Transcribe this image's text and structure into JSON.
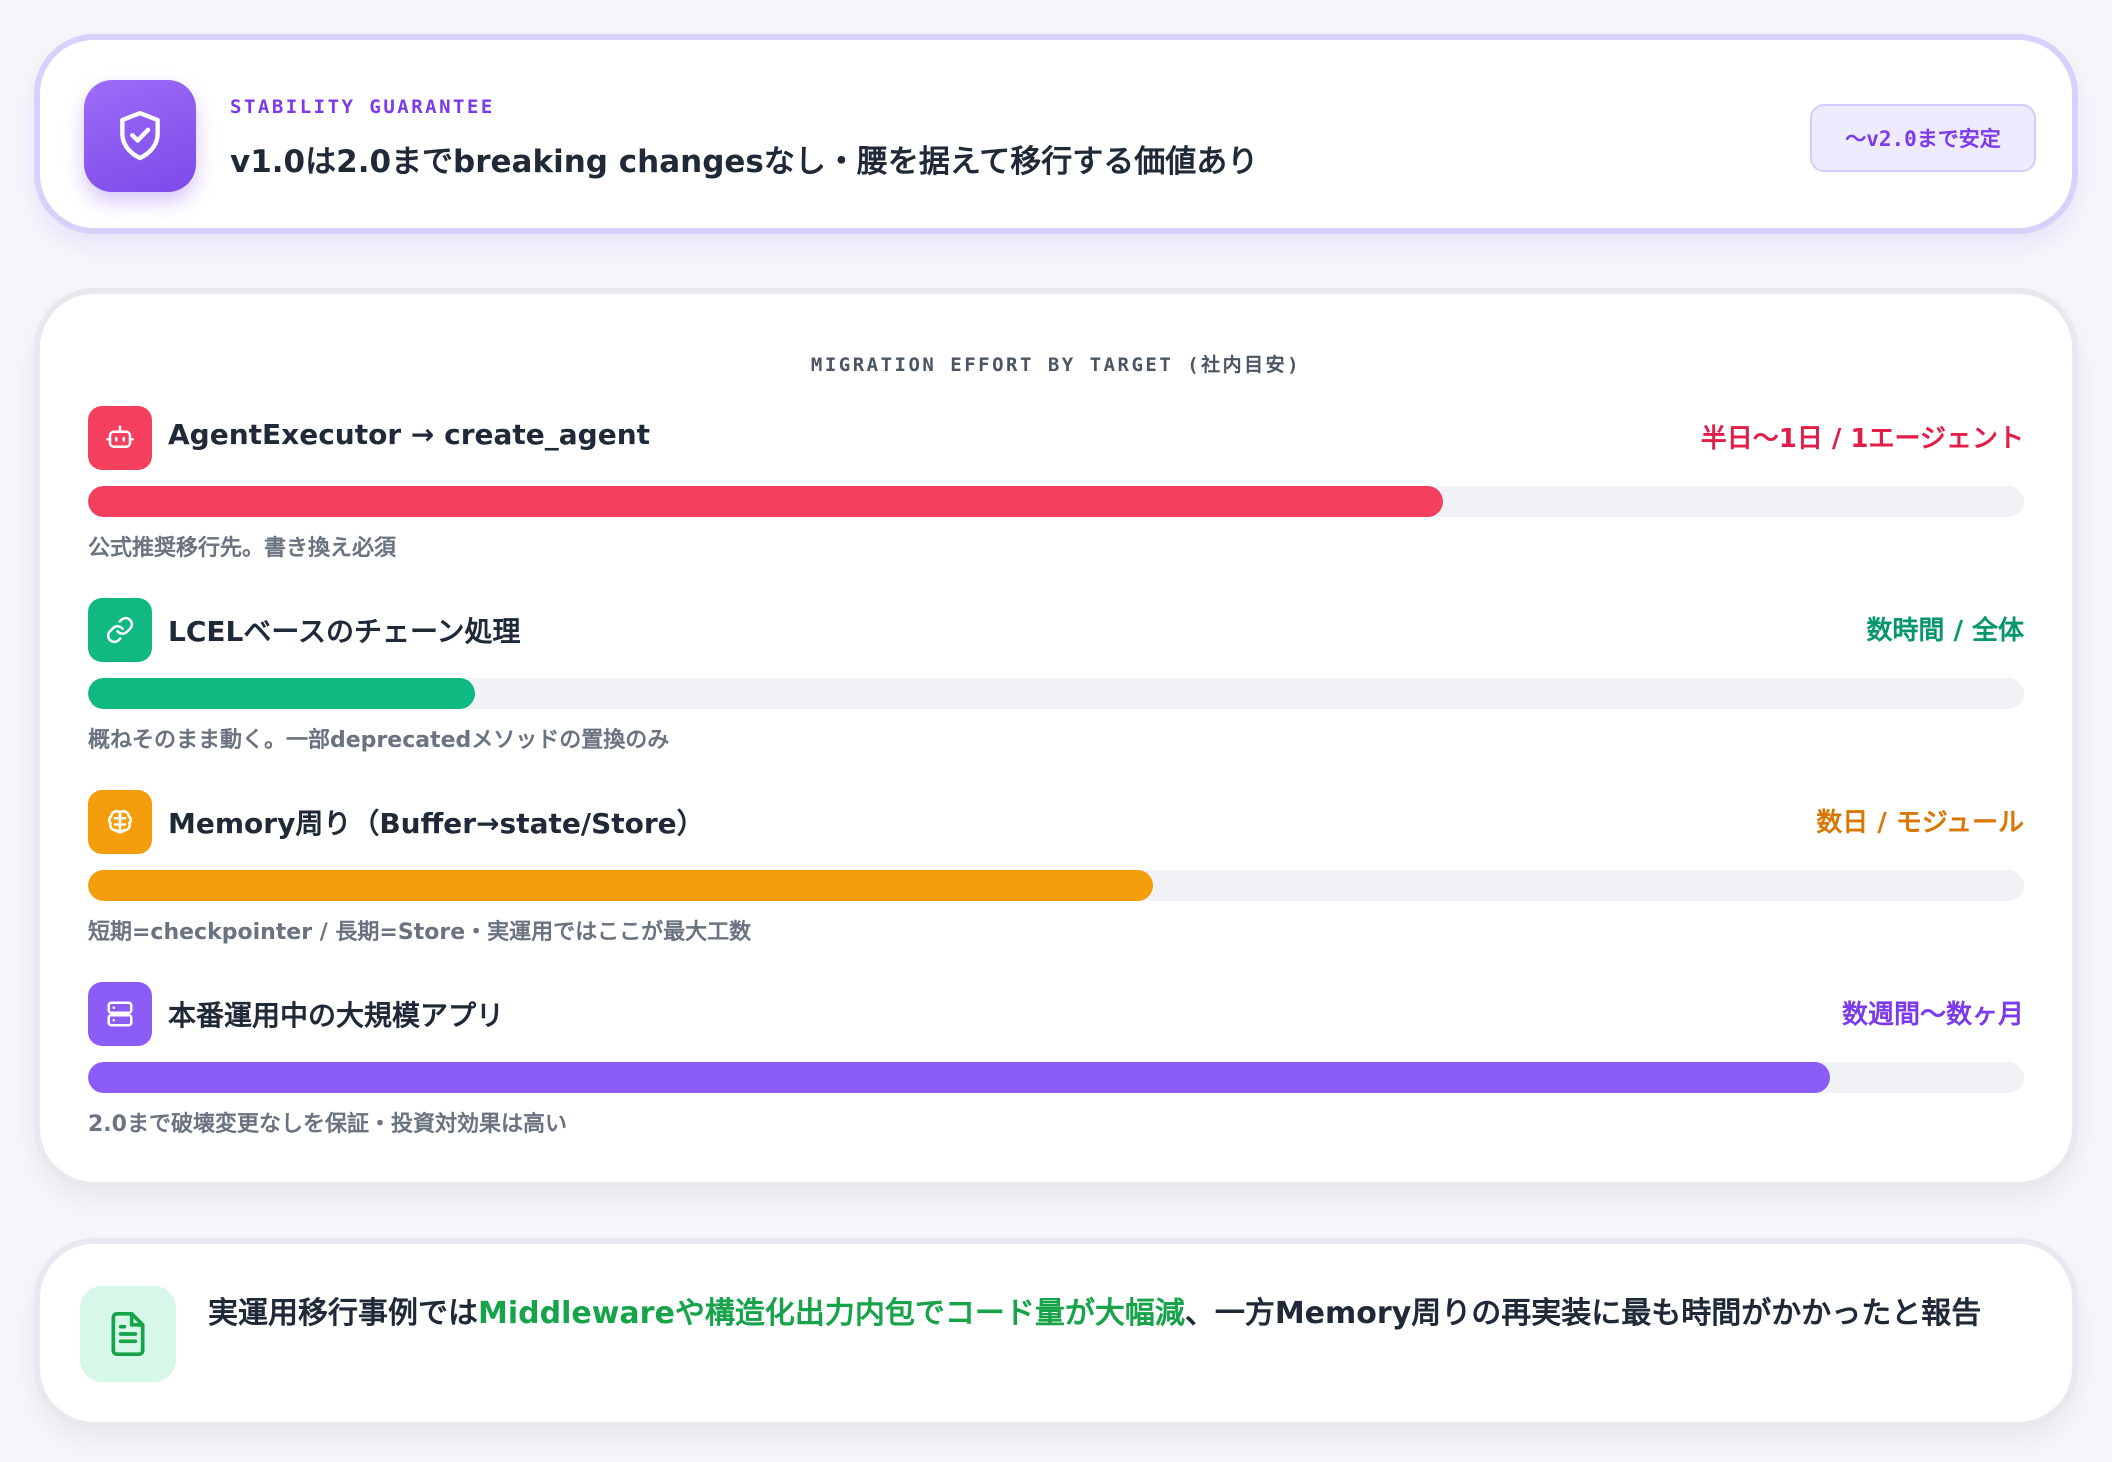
{
  "header": {
    "eyebrow": "STABILITY GUARANTEE",
    "title": "v1.0は2.0までbreaking changesなし・腰を据えて移行する価値あり",
    "badge": "〜v2.0まで安定",
    "icon": "shield-check-icon"
  },
  "effort": {
    "title": "MIGRATION EFFORT BY TARGET (社内目安)",
    "rows": [
      {
        "icon": "robot-icon",
        "label": "AgentExecutor → create_agent",
        "value": "半日〜1日 / 1エージェント",
        "note": "公式推奨移行先。書き換え必須",
        "progress": 0.7,
        "color": "#f43f5e"
      },
      {
        "icon": "link-icon",
        "label": "LCELベースのチェーン処理",
        "value": "数時間 / 全体",
        "note": "概ねそのまま動く。一部deprecatedメソッドの置換のみ",
        "progress": 0.2,
        "color": "#10b981"
      },
      {
        "icon": "brain-icon",
        "label": "Memory周り（Buffer→state/Store）",
        "value": "数日 / モジュール",
        "note": "短期=checkpointer / 長期=Store・実運用ではここが最大工数",
        "progress": 0.55,
        "color": "#f59e0b"
      },
      {
        "icon": "server-icon",
        "label": "本番運用中の大規模アプリ",
        "value": "数週間〜数ヶ月",
        "note": "2.0まで破壊変更なしを保証・投資対効果は高い",
        "progress": 0.9,
        "color": "#8b5cf6"
      }
    ]
  },
  "report": {
    "icon": "document-icon",
    "text_before": "実運用移行事例では",
    "text_highlight": "Middlewareや構造化出力内包でコード量が大幅減",
    "text_after": "、一方Memory周りの再実装に最も時間がかかったと報告"
  },
  "colors": {
    "accent": "#7c3aed",
    "highlight": "#16a34a",
    "row_value_colors": [
      "#e11d48",
      "#059669",
      "#d97706",
      "#7c3aed"
    ]
  }
}
